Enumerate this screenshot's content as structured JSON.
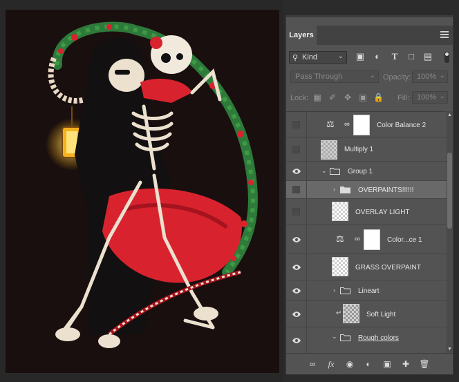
{
  "panel": {
    "tab_label": "Layers",
    "collapse_glyph": "«",
    "close_glyph": "×"
  },
  "filter": {
    "kind_label": "Kind",
    "icons": [
      "image-filter-icon",
      "adjustment-filter-icon",
      "type-filter-icon",
      "shape-filter-icon",
      "smart-object-filter-icon"
    ]
  },
  "blend": {
    "mode": "Pass Through",
    "opacity_label": "Opacity:",
    "opacity_value": "100%"
  },
  "lock": {
    "label": "Lock:",
    "fill_label": "Fill:",
    "fill_value": "100%"
  },
  "layers": [
    {
      "name": "Color Balance 2",
      "visible": false
    },
    {
      "name": "Multiply 1",
      "visible": false
    },
    {
      "name": "Group 1",
      "visible": true
    },
    {
      "name": "OVERPAINTS!!!!!!",
      "visible": false
    },
    {
      "name": "OVERLAY LIGHT",
      "visible": false
    },
    {
      "name": "Color...ce 1",
      "visible": true
    },
    {
      "name": "GRASS OVERPAINT",
      "visible": true
    },
    {
      "name": "Lineart",
      "visible": true
    },
    {
      "name": "Soft Light",
      "visible": true
    },
    {
      "name": "Rough colors",
      "visible": true
    }
  ],
  "bottom_icons": [
    "link-layers-icon",
    "fx-icon",
    "add-mask-icon",
    "new-fill-adjustment-icon",
    "new-group-icon",
    "new-layer-icon",
    "delete-layer-icon"
  ],
  "bottom_fx_label": "fx",
  "colors": {
    "panel_bg": "#535353",
    "selected_row": "#696969",
    "canvas_bg": "#1a0f0f",
    "accent_red": "#d8232f"
  }
}
